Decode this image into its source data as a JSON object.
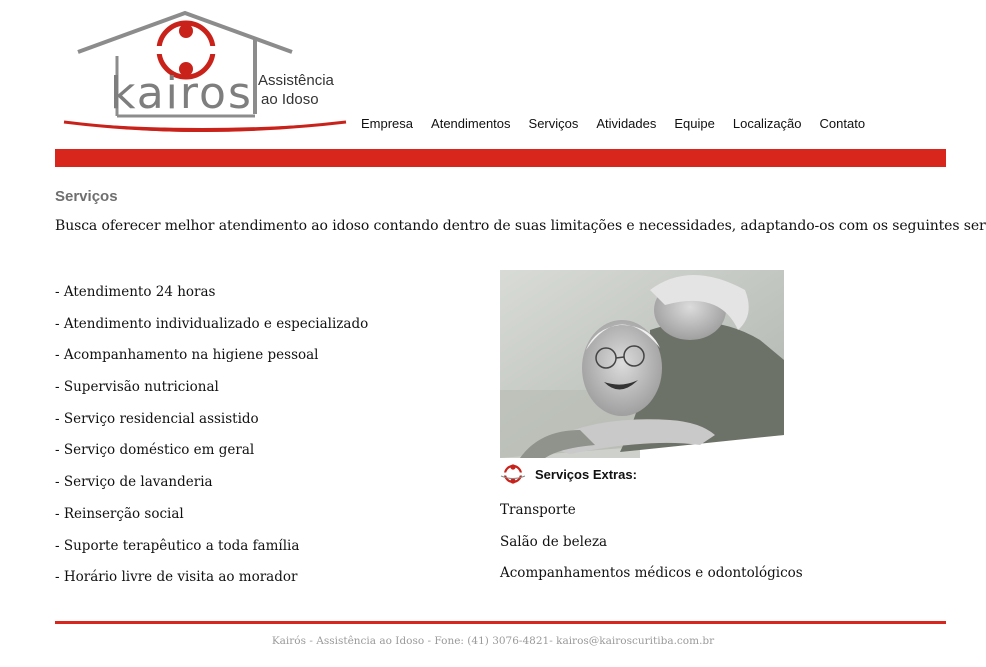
{
  "logo": {
    "brand": "kairos",
    "tagline_line1": "Assistência",
    "tagline_line2": "ao Idoso"
  },
  "nav": {
    "items": [
      "Empresa",
      "Atendimentos",
      "Serviços",
      "Atividades",
      "Equipe",
      "Localização",
      "Contato"
    ]
  },
  "colors": {
    "accent": "#d9261c",
    "title_gray": "#6f6f6f",
    "footer_gray": "#9a9a9a"
  },
  "main": {
    "title": "Serviços",
    "intro": "Busca oferecer melhor atendimento ao idoso contando dentro de suas limitações e necessidades, adaptando-os com os seguintes serviços:",
    "services": [
      "- Atendimento 24 horas",
      "- Atendimento individualizado e especializado",
      "- Acompanhamento na higiene pessoal",
      "- Supervisão nutricional",
      "- Serviço residencial assistido",
      "- Serviço doméstico em geral",
      "- Serviço de lavanderia",
      "- Reinserção social",
      "- Suporte terapêutico a toda família",
      "- Horário livre de visita ao morador"
    ],
    "extras": {
      "heading": "Serviços Extras:",
      "icon": "kairos-emblem-icon",
      "items": [
        "Transporte",
        "Salão de beleza",
        "Acompanhamentos médicos e odontológicos"
      ]
    },
    "photo": {
      "icon": "elderly-couple-photo"
    }
  },
  "footer": {
    "text": "Kairós - Assistência ao Idoso - Fone: (41) 3076-4821- kairos@kairoscuritiba.com.br"
  }
}
